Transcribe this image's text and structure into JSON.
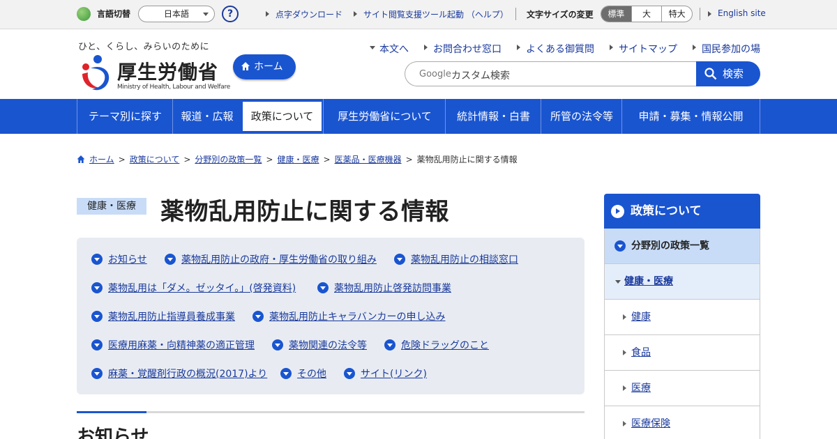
{
  "utility": {
    "lang_label": "言語切替",
    "lang_value": "日本語",
    "help_icon": "question-icon",
    "links": [
      "点字ダウンロード",
      "サイト閲覧支援ツール起動 （ヘルプ）"
    ],
    "font_size_label": "文字サイズの変更",
    "font_sizes": [
      "標準",
      "大",
      "特大"
    ],
    "english_link": "English site"
  },
  "header": {
    "tagline": "ひと、くらし、みらいのために",
    "logo_text": "厚生労働省",
    "logo_sub": "Ministry of Health, Labour and Welfare",
    "home_label": "ホーム",
    "links": [
      "本文へ",
      "お問合わせ窓口",
      "よくある御質問",
      "サイトマップ",
      "国民参加の場"
    ],
    "search_brand": "Google",
    "search_placeholder": "カスタム検索",
    "search_button": "検索"
  },
  "nav": [
    "テーマ別に探す",
    "報道・広報",
    "政策について",
    "厚生労働省について",
    "統計情報・白書",
    "所管の法令等",
    "申請・募集・情報公開"
  ],
  "breadcrumb": [
    "ホーム",
    "政策について",
    "分野別の政策一覧",
    "健康・医療",
    "医薬品・医療機器",
    "薬物乱用防止に関する情報"
  ],
  "page": {
    "category": "健康・医療",
    "title": "薬物乱用防止に関する情報",
    "anchors": [
      "お知らせ",
      "薬物乱用防止の政府・厚生労働省の取り組み",
      "薬物乱用防止の相談窓口",
      "薬物乱用は「ダメ。ゼッタイ。」(啓発資料)",
      "薬物乱用防止啓発訪問事業",
      "薬物乱用防止指導員養成事業",
      "薬物乱用防止キャラバンカーの申し込み",
      "医療用麻薬・向精神薬の適正管理",
      "薬物関連の法令等",
      "危険ドラッグのこと",
      "麻薬・覚醒剤行政の概況(2017)より",
      "その他",
      "サイト(リンク)"
    ],
    "section_title": "お知らせ"
  },
  "side": {
    "title": "政策について",
    "level1": "分野別の政策一覧",
    "level2": "健康・医療",
    "items": [
      "健康",
      "食品",
      "医療",
      "医療保険"
    ]
  }
}
